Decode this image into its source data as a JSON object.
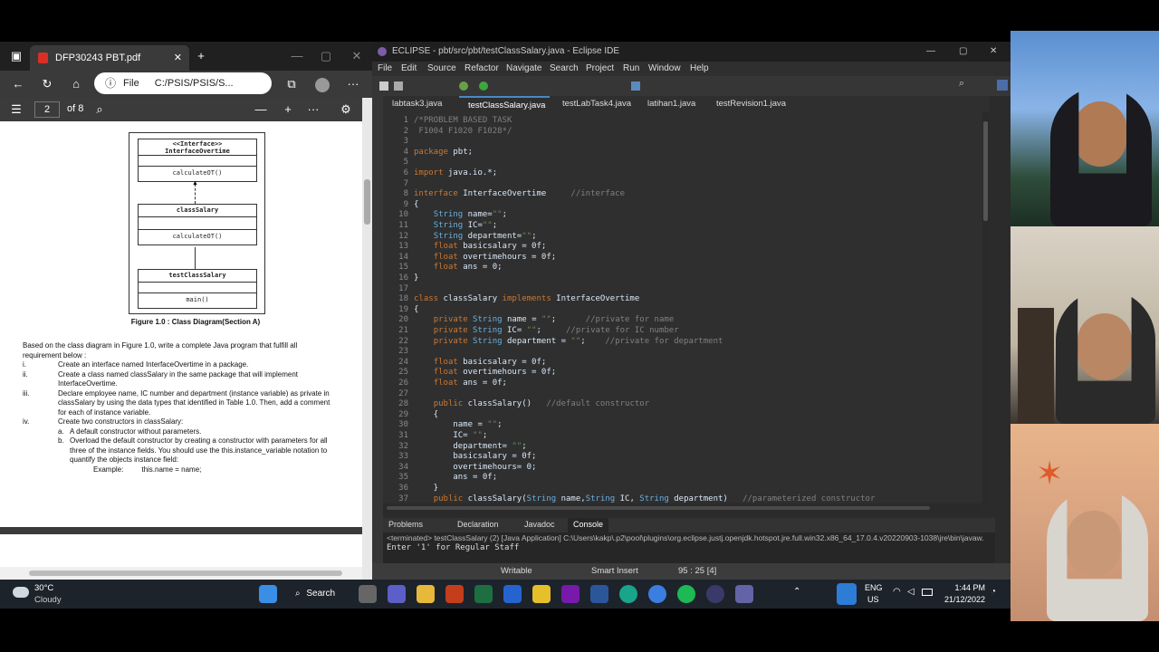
{
  "pdf": {
    "tab_title": "DFP30243 PBT.pdf",
    "address_label": "File",
    "address": "C:/PSIS/PSIS/S...",
    "page_number": "2",
    "page_total": "of 8",
    "figure_caption": "Figure 1.0 : Class Diagram(Section A)",
    "uml": {
      "interface_stereotype": "<<Interface>>",
      "interface_name": "InterfaceOvertime",
      "interface_method": "calculateOT()",
      "class_name": "classSalary",
      "class_method": "calculateOT()",
      "test_name": "testClassSalary",
      "test_method": "main()"
    },
    "intro": "Based on the class diagram in Figure 1.0, write a complete Java program that fulfill all requirement below :",
    "items": [
      {
        "num": "i.",
        "text": "Create an interface named InterfaceOvertime in a package."
      },
      {
        "num": "ii.",
        "text": "Create a class named classSalary in the same package that will implement InterfaceOvertime."
      },
      {
        "num": "iii.",
        "text": "Declare employee name, IC number and department (instance variable) as private in classSalary by using the data types that identified in Table 1.0. Then, add a comment for each of instance variable."
      },
      {
        "num": "iv.",
        "text": "Create two constructors in classSalary:"
      }
    ],
    "sub_items": [
      {
        "num": "a.",
        "text": "A default constructor without parameters."
      },
      {
        "num": "b.",
        "text": "Overload the default constructor by creating a constructor with parameters for all three of the instance fields. You should use the this.instance_variable notation to quantify the objects instance field:"
      }
    ],
    "example_label": "Example:",
    "example_code": "this.name = name;"
  },
  "eclipse": {
    "title": "ECLIPSE - pbt/src/pbt/testClassSalary.java - Eclipse IDE",
    "menu": [
      "File",
      "Edit",
      "Source",
      "Refactor",
      "Navigate",
      "Search",
      "Project",
      "Run",
      "Window",
      "Help"
    ],
    "tabs": [
      "labtask3.java",
      "testClassSalary.java",
      "testLabTask4.java",
      "latihan1.java",
      "testRevision1.java"
    ],
    "active_tab": "testClassSalary.java",
    "code_lines": [
      {
        "n": "1",
        "t": "/*PROBLEM BASED TASK"
      },
      {
        "n": "2",
        "t": " F1004 F1020 F1028*/"
      },
      {
        "n": "3",
        "t": ""
      },
      {
        "n": "4",
        "t": "package pbt;"
      },
      {
        "n": "5",
        "t": ""
      },
      {
        "n": "6",
        "t": "import java.io.*;"
      },
      {
        "n": "7",
        "t": ""
      },
      {
        "n": "8",
        "t": "interface InterfaceOvertime     //interface"
      },
      {
        "n": "9",
        "t": "{"
      },
      {
        "n": "10",
        "t": "    String name=\"\";"
      },
      {
        "n": "11",
        "t": "    String IC=\"\";"
      },
      {
        "n": "12",
        "t": "    String department=\"\";"
      },
      {
        "n": "13",
        "t": "    float basicsalary = 0f;"
      },
      {
        "n": "14",
        "t": "    float overtimehours = 0f;"
      },
      {
        "n": "15",
        "t": "    float ans = 0;"
      },
      {
        "n": "16",
        "t": "}"
      },
      {
        "n": "17",
        "t": ""
      },
      {
        "n": "18",
        "t": "class classSalary implements InterfaceOvertime"
      },
      {
        "n": "19",
        "t": "{"
      },
      {
        "n": "20",
        "t": "    private String name = \"\";      //private for name"
      },
      {
        "n": "21",
        "t": "    private String IC= \"\";     //private for IC number"
      },
      {
        "n": "22",
        "t": "    private String department = \"\";    //private for department"
      },
      {
        "n": "23",
        "t": ""
      },
      {
        "n": "24",
        "t": "    float basicsalary = 0f;"
      },
      {
        "n": "25",
        "t": "    float overtimehours = 0f;"
      },
      {
        "n": "26",
        "t": "    float ans = 0f;"
      },
      {
        "n": "27",
        "t": ""
      },
      {
        "n": "28",
        "t": "    public classSalary()   //default constructor"
      },
      {
        "n": "29",
        "t": "    {"
      },
      {
        "n": "30",
        "t": "        name = \"\";"
      },
      {
        "n": "31",
        "t": "        IC= \"\";"
      },
      {
        "n": "32",
        "t": "        department= \"\";"
      },
      {
        "n": "33",
        "t": "        basicsalary = 0f;"
      },
      {
        "n": "34",
        "t": "        overtimehours= 0;"
      },
      {
        "n": "35",
        "t": "        ans = 0f;"
      },
      {
        "n": "36",
        "t": "    }"
      },
      {
        "n": "37",
        "t": "    public classSalary(String name,String IC, String department)   //parameterized constructor"
      }
    ],
    "console_tabs": [
      "Problems",
      "Declaration",
      "Javadoc",
      "Console"
    ],
    "active_console_tab": "Console",
    "console_header": "<terminated> testClassSalary (2) [Java Application] C:\\Users\\kakp\\.p2\\pool\\plugins\\org.eclipse.justj.openjdk.hotspot.jre.full.win32.x86_64_17.0.4.v20220903-1038\\jre\\bin\\javaw.",
    "console_output": "Enter '1' for Regular Staff",
    "status": {
      "writable": "Writable",
      "insert": "Smart Insert",
      "position": "95 : 25 [4]"
    }
  },
  "taskbar": {
    "temperature": "30°C",
    "weather": "Cloudy",
    "search_label": "Search",
    "lang_top": "ENG",
    "lang_bottom": "US",
    "time": "1:44 PM",
    "date": "21/12/2022"
  },
  "colors": {
    "keyword": "#cc7832",
    "type": "#6ab0de",
    "string": "#6a8759",
    "comment": "#808080",
    "field": "#9876aa",
    "editor_bg": "#2f2f2f",
    "taskbar_bg": "#1d232b"
  }
}
